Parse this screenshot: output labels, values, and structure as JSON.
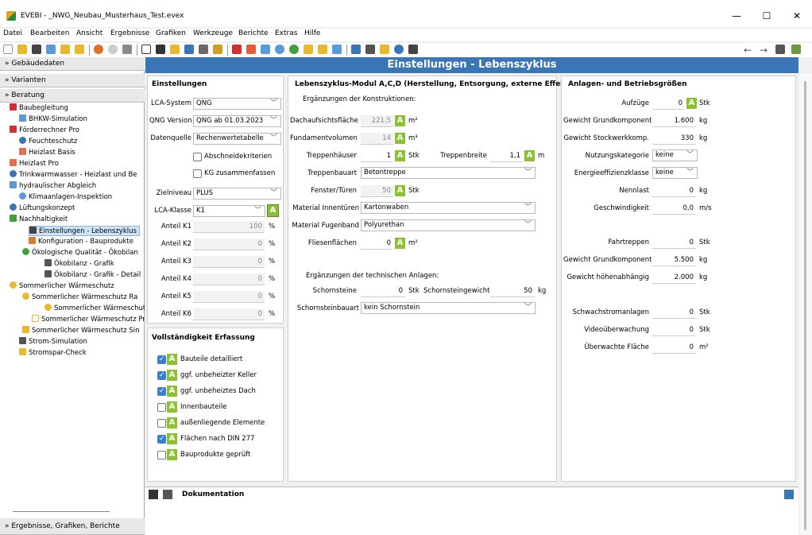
{
  "window": {
    "title": "EVEBI  -  _NWG_Neubau_Musterhaus_Test.evex",
    "min": "—",
    "max": "☐",
    "close": "✕"
  },
  "menu": [
    "Datei",
    "Bearbeiten",
    "Ansicht",
    "Ergebnisse",
    "Grafiken",
    "Werkzeuge",
    "Berichte",
    "Extras",
    "Hilfe"
  ],
  "nav": {
    "back": "←",
    "forward": "→"
  },
  "left": {
    "gebaeudedaten": "» Gebäudedaten",
    "varianten": "» Varianten",
    "beratung": "» Beratung",
    "ergebnisse": "» Ergebnisse, Grafiken, Berichte",
    "tree": [
      "Baubegleitung",
      "BHKW-Simulation",
      "Förderrechner Pro",
      "Feuchteschutz",
      "Heizlast Basis",
      "Heizlast Pro",
      "Trinkwarmwasser - Heizlast und Be",
      "hydraulischer Abgleich",
      "Klimaanlagen-Inspektion",
      "Lüftungskonzept",
      "Nachhaltigkeit",
      "Einstellungen - Lebenszyklus",
      "Konfiguration - Bauprodukte",
      "Ökologische Qualität - Ökobilan",
      "Ökobilanz - Grafik",
      "Ökobilanz - Grafik - Detail",
      "Sommerlicher Wärmeschutz",
      "Sommerlicher Wärmeschutz Ra",
      "Sommerlicher Wärmeschutz",
      "Sommerlicher Wärmeschutz Prc",
      "Sommerlicher Wärmeschutz Sin",
      "Strom-Simulation",
      "Stromspar-Check"
    ]
  },
  "banner": "Einstellungen - Lebenszyklus",
  "einstellungen": {
    "title": "Einstellungen",
    "lca_system_label": "LCA-System",
    "lca_system": "QNG",
    "qng_version_label": "QNG Version",
    "qng_version": "QNG ab 01.03.2023",
    "datenquelle_label": "Datenquelle",
    "datenquelle": "Rechenwertetabelle",
    "abschneide": "Abschneidekriterien",
    "kg_zusammen": "KG zusammenfassen",
    "zielniveau_label": "Zielniveau",
    "zielniveau": "PLUS",
    "lca_klasse_label": "LCA-Klasse",
    "lca_klasse": "K1",
    "anteile": [
      {
        "label": "Anteil K1",
        "value": "100"
      },
      {
        "label": "Anteil K2",
        "value": "0"
      },
      {
        "label": "Anteil K3",
        "value": "0"
      },
      {
        "label": "Anteil K4",
        "value": "0"
      },
      {
        "label": "Anteil K5",
        "value": "0"
      },
      {
        "label": "Anteil K6",
        "value": "0"
      }
    ],
    "percent": "%"
  },
  "vollstaendigkeit": {
    "title": "Vollständigkeit Erfassung",
    "items": [
      {
        "label": "Bauteile detailliert",
        "checked": true
      },
      {
        "label": "ggf. unbeheizter Keller",
        "checked": true
      },
      {
        "label": "ggf. unbeheiztes Dach",
        "checked": true
      },
      {
        "label": "Innenbauteile",
        "checked": false
      },
      {
        "label": "außenliegende Elemente",
        "checked": false
      },
      {
        "label": "Flächen nach DIN 277",
        "checked": true
      },
      {
        "label": "Bauprodukte geprüft",
        "checked": false
      }
    ]
  },
  "modul": {
    "title": "Lebenszyklus-Modul A,C,D (Herstellung, Entsorgung, externe Effekte)",
    "ergaenzung_konstr": "Ergänzungen der Konstruktionen:",
    "dachaufsicht_label": "Dachaufsichtsfläche",
    "dachaufsicht": "221,5",
    "u_m2": "m²",
    "fundament_label": "Fundamentvolumen",
    "fundament": "14",
    "u_m3": "m³",
    "treppenhaeuser_label": "Treppenhäuser",
    "treppenhaeuser": "1",
    "u_stk": "Stk",
    "treppenbreite_label": "Treppenbreite",
    "treppenbreite": "1,1",
    "u_m": "m",
    "treppenbauart_label": "Treppenbauart",
    "treppenbauart": "Betontreppe",
    "fenster_label": "Fenster/Türen",
    "fenster": "50",
    "mat_innen_label": "Material Innentüren",
    "mat_innen": "Kartonwaben",
    "mat_fugen_label": "Material Fugenband",
    "mat_fugen": "Polyurethan",
    "fliesen_label": "Fliesenflächen",
    "fliesen": "0",
    "ergaenzung_anl": "Ergänzungen der technischen Anlagen:",
    "schornsteine_label": "Schornsteine",
    "schornsteine": "0",
    "schornsteingewicht_label": "Schornsteingewicht",
    "schornsteingewicht": "50",
    "u_kg": "kg",
    "schornsteinbau_label": "Schornsteinbauart",
    "schornsteinbau": "kein Schornstein"
  },
  "anlagen": {
    "title": "Anlagen- und Betriebsgrößen",
    "rows": [
      {
        "label": "Aufzüge",
        "value": "0",
        "unit": "Stk",
        "badge": true,
        "type": "input"
      },
      {
        "label": "Gewicht Grundkomponente",
        "value": "1.600",
        "unit": "kg",
        "type": "input"
      },
      {
        "label": "Gewicht Stockwerkkomp.",
        "value": "330",
        "unit": "kg",
        "type": "input"
      },
      {
        "label": "Nutzungskategorie",
        "value": "keine",
        "type": "select"
      },
      {
        "label": "Energieeffizienzklasse",
        "value": "keine",
        "type": "select"
      },
      {
        "label": "Nennlast",
        "value": "0",
        "unit": "kg",
        "type": "input"
      },
      {
        "label": "Geschwindigkeit",
        "value": "0,0",
        "unit": "m/s",
        "type": "input"
      },
      {
        "label": "Fahrtreppen",
        "value": "0",
        "unit": "Stk",
        "type": "input"
      },
      {
        "label": "Gewicht Grundkomponente",
        "value": "5.500",
        "unit": "kg",
        "type": "input"
      },
      {
        "label": "Gewicht höhenabhängig",
        "value": "2.000",
        "unit": "kg",
        "type": "input"
      },
      {
        "label": "Schwachstromanlagen",
        "value": "0",
        "unit": "Stk",
        "type": "input"
      },
      {
        "label": "Videoüberwachung",
        "value": "0",
        "unit": "Stk",
        "type": "input"
      },
      {
        "label": "Überwachte Fläche",
        "value": "0",
        "unit": "m²",
        "type": "input"
      }
    ]
  },
  "doku": {
    "title": "Dokumentation"
  },
  "badge": "A"
}
